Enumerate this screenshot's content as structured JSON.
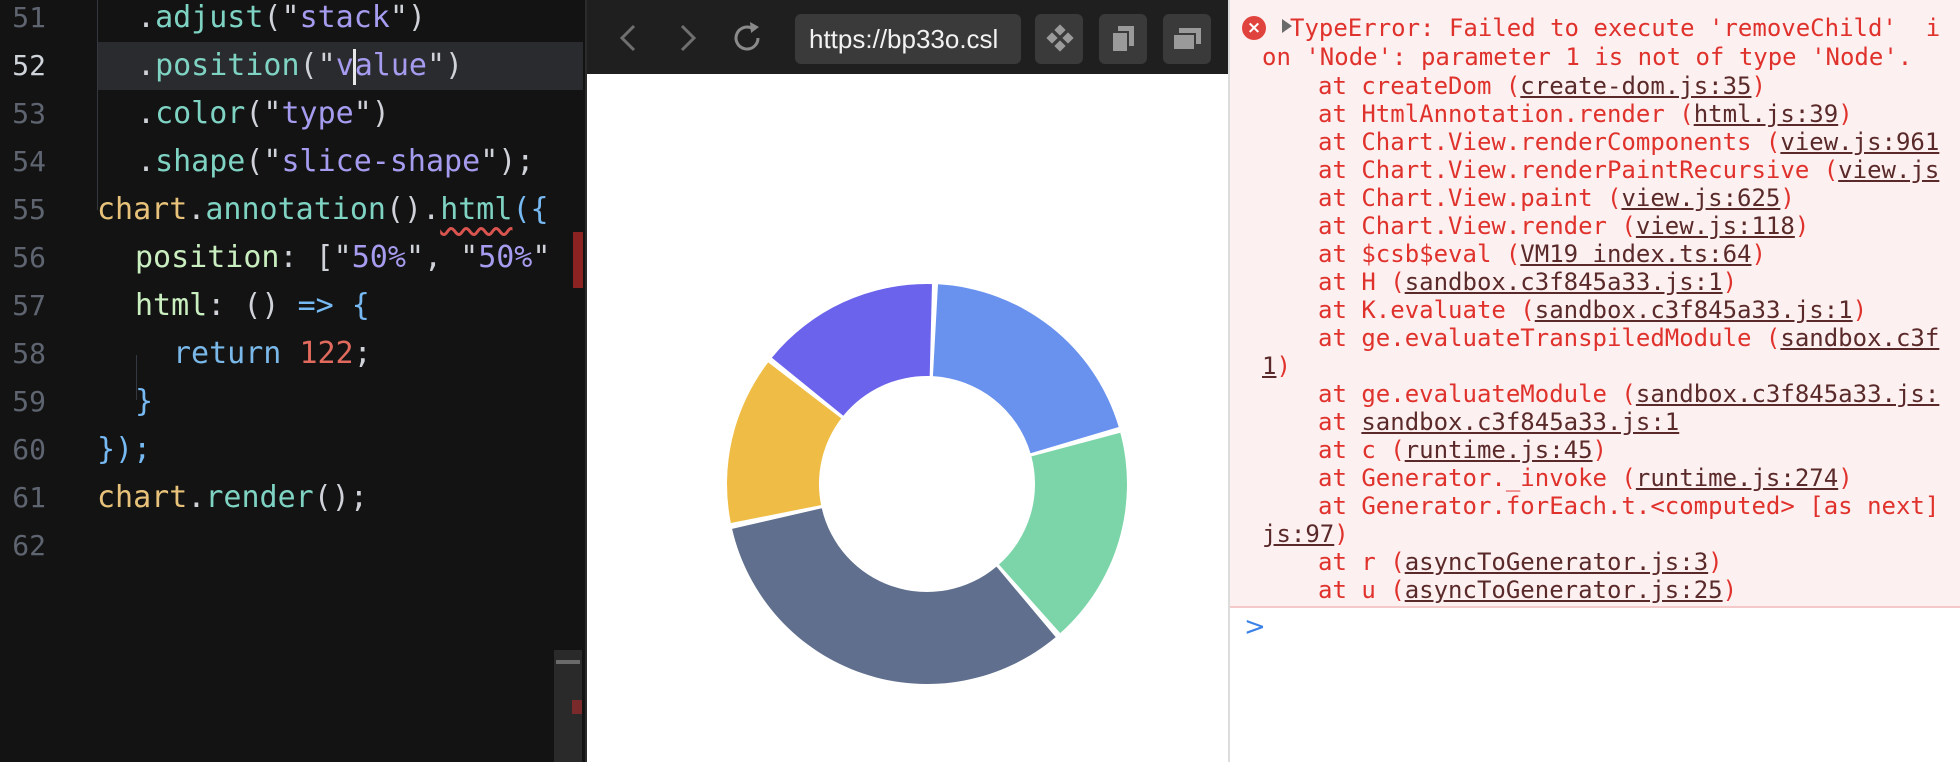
{
  "editor": {
    "line_numbers": [
      "51",
      "52",
      "53",
      "54",
      "55",
      "56",
      "57",
      "58",
      "59",
      "60",
      "61",
      "62"
    ],
    "active_line": "52",
    "code": {
      "l51": {
        "dot": ".",
        "method": "adjust",
        "open": "(\"",
        "arg": "stack",
        "close": "\")"
      },
      "l52": {
        "dot": ".",
        "method": "position",
        "open": "(\"",
        "arg_a": "v",
        "arg_b": "alue",
        "close": "\")"
      },
      "l53": {
        "dot": ".",
        "method": "color",
        "open": "(\"",
        "arg": "type",
        "close": "\")"
      },
      "l54": {
        "dot": ".",
        "method": "shape",
        "open": "(\"",
        "arg": "slice-shape",
        "close": "\");"
      },
      "l55": {
        "obj": "chart",
        "dot1": ".",
        "method": "annotation",
        "parens": "()",
        "dot2": ".",
        "method2": "html",
        "close": "({"
      },
      "l56": {
        "prop": "position",
        "colon": ": [\"",
        "v1": "50%",
        "mid": "\", \"",
        "v2": "50%",
        "end": "\""
      },
      "l57": {
        "prop": "html",
        "colon": ": () ",
        "arrow": "=>",
        "brace": " {"
      },
      "l58": {
        "kw": "return",
        "num": "122",
        "semi": ";"
      },
      "l59": {
        "brace": "}"
      },
      "l60": {
        "text": "});"
      },
      "l61": {
        "obj": "chart",
        "dot": ".",
        "method": "render",
        "end": "();"
      }
    }
  },
  "browser": {
    "back_icon": "chevron-left-icon",
    "forward_icon": "chevron-right-icon",
    "reload_icon": "reload-icon",
    "url": "https://bp33o.csl",
    "toolbar_icons": [
      "codesandbox-icon",
      "copy-icon",
      "window-icon"
    ]
  },
  "chart_data": {
    "type": "pie",
    "donut": true,
    "slices": [
      {
        "value": 20,
        "color": "#6892ee"
      },
      {
        "value": 18,
        "color": "#7cd5a9"
      },
      {
        "value": 33,
        "color": "#5f6f8d"
      },
      {
        "value": 14,
        "color": "#efbd45"
      },
      {
        "value": 15,
        "color": "#6c63ec"
      }
    ]
  },
  "console": {
    "error_icon": "error-icon",
    "lines": [
      {
        "t": "TypeError: Failed to execute 'removeChild'  i",
        "x": 60,
        "y": 14
      },
      {
        "t": "on 'Node': parameter 1 is not of type 'Node'.",
        "x": 32,
        "y": 43
      },
      {
        "pre": "at createDom (",
        "link": "create-dom.js:35",
        "post": ")"
      },
      {
        "pre": "at HtmlAnnotation.render (",
        "link": "html.js:39",
        "post": ")"
      },
      {
        "pre": "at Chart.View.renderComponents (",
        "link": "view.js:961",
        "post": ""
      },
      {
        "pre": "at Chart.View.renderPaintRecursive (",
        "link": "view.js",
        "post": ""
      },
      {
        "pre": "at Chart.View.paint (",
        "link": "view.js:625",
        "post": ")"
      },
      {
        "pre": "at Chart.View.render (",
        "link": "view.js:118",
        "post": ")"
      },
      {
        "pre": "at $csb$eval (",
        "link": "VM19 index.ts:64",
        "post": ")"
      },
      {
        "pre": "at H (",
        "link": "sandbox.c3f845a33.js:1",
        "post": ")"
      },
      {
        "pre": "at K.evaluate (",
        "link": "sandbox.c3f845a33.js:1",
        "post": ")"
      },
      {
        "pre": "at ge.evaluateTranspiledModule (",
        "link": "sandbox.c3f",
        "post": ""
      },
      {
        "pre_raw": "",
        "link": "1",
        "post": ")",
        "wrap": true
      },
      {
        "pre": "at ge.evaluateModule (",
        "link": "sandbox.c3f845a33.js:",
        "post": ""
      },
      {
        "pre": "at ",
        "link": "sandbox.c3f845a33.js:1",
        "post": ""
      },
      {
        "pre": "at c (",
        "link": "runtime.js:45",
        "post": ")"
      },
      {
        "pre": "at Generator._invoke (",
        "link": "runtime.js:274",
        "post": ")"
      },
      {
        "pre": "at Generator.forEach.t.<computed> [as next] ",
        "link": "",
        "post": ""
      },
      {
        "pre_raw": "",
        "link": "js:97",
        "post": ")",
        "wrap": true
      },
      {
        "pre": "at r (",
        "link": "asyncToGenerator.js:3",
        "post": ")"
      },
      {
        "pre": "at u (",
        "link": "asyncToGenerator.js:25",
        "post": ")"
      }
    ],
    "prompt": ">",
    "colors": {
      "error": "#e0322c",
      "error_bg": "#fdf0f0"
    }
  }
}
